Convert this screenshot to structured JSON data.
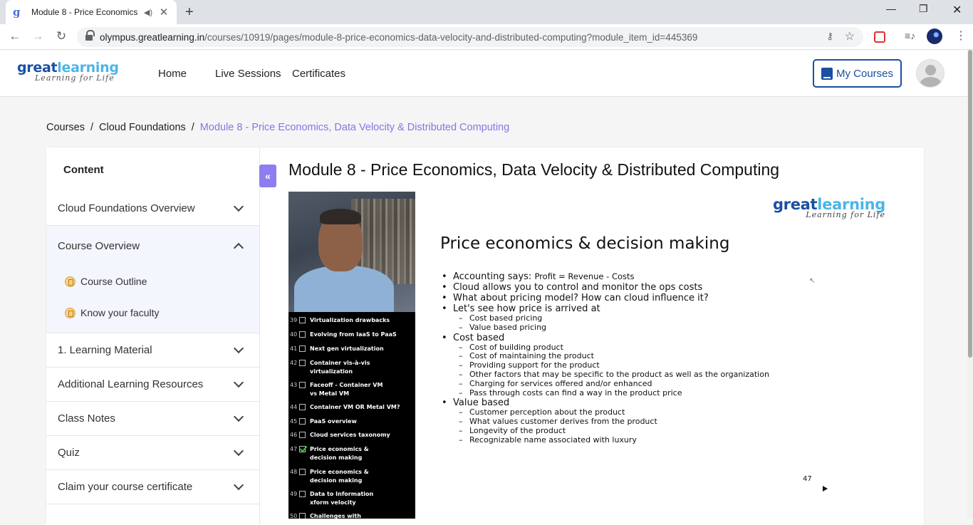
{
  "browser": {
    "tab_title": "Module 8 - Price Economics, Data Velocity & Distributed Computing",
    "url_host": "olympus.greatlearning.in",
    "url_path": "/courses/10919/pages/module-8-price-economics-data-velocity-and-distributed-computing?module_item_id=445369"
  },
  "header": {
    "logo_word_a": "great",
    "logo_word_b": "learning",
    "logo_tagline": "Learning for Life",
    "nav": [
      "Home",
      "Live Sessions",
      "Certificates"
    ],
    "my_courses": "My Courses"
  },
  "breadcrumb": {
    "items": [
      "Courses",
      "Cloud Foundations"
    ],
    "separator": "/",
    "current": "Module 8 - Price Economics, Data Velocity & Distributed Computing"
  },
  "sidebar": {
    "heading": "Content",
    "sections": [
      {
        "label": "Cloud Foundations Overview"
      },
      {
        "label": "Course Overview",
        "open": true,
        "items": [
          "Course Outline",
          "Know your faculty"
        ]
      },
      {
        "label": "1. Learning Material"
      },
      {
        "label": "Additional Learning Resources"
      },
      {
        "label": "Class Notes"
      },
      {
        "label": "Quiz"
      },
      {
        "label": "Claim your course certificate"
      }
    ],
    "collapse_glyph": "«"
  },
  "module": {
    "title": "Module 8 - Price Economics, Data Velocity & Distributed Computing"
  },
  "video": {
    "toc": [
      {
        "num": "39",
        "lines": [
          "Virtualization drawbacks"
        ],
        "checked": false
      },
      {
        "num": "40",
        "lines": [
          "Evolving from IaaS to PaaS"
        ],
        "checked": false
      },
      {
        "num": "41",
        "lines": [
          "Next gen virtualization"
        ],
        "checked": false
      },
      {
        "num": "42",
        "lines": [
          "Container vis-à-vis",
          "virtualization"
        ],
        "checked": false
      },
      {
        "num": "43",
        "lines": [
          "Faceoff - Container VM",
          "vs Metal VM"
        ],
        "checked": false
      },
      {
        "num": "44",
        "lines": [
          "Container VM OR Metal VM?"
        ],
        "checked": false
      },
      {
        "num": "45",
        "lines": [
          "PaaS overview"
        ],
        "checked": false
      },
      {
        "num": "46",
        "lines": [
          "Cloud services taxonomy"
        ],
        "checked": false
      },
      {
        "num": "47",
        "lines": [
          "Price economics &",
          "decision making"
        ],
        "checked": true
      },
      {
        "num": "48",
        "lines": [
          "Price economics &",
          "decision making"
        ],
        "checked": false
      },
      {
        "num": "49",
        "lines": [
          "Data to Information",
          "xform velocity"
        ],
        "checked": false
      },
      {
        "num": "50",
        "lines": [
          "Challenges with"
        ],
        "checked": false
      }
    ],
    "slide": {
      "logo_word_a": "great",
      "logo_word_b": "learning",
      "logo_tagline": "Learning for Life",
      "heading": "Price economics & decision making",
      "accounting_prefix": "Accounting says: ",
      "accounting_formula": "Profit = Revenue - Costs",
      "bullets_top": [
        "Cloud allows you to control and monitor the ops costs",
        "What about pricing model? How can cloud influence it?",
        "Let's see how price is arrived at"
      ],
      "pricing_subs": [
        "Cost based pricing",
        "Value based pricing"
      ],
      "cost_based": "Cost based",
      "cost_subs": [
        "Cost of building product",
        "Cost of maintaining the product",
        "Providing support for the product",
        "Other factors that may be specific to the product as well as the organization",
        "Charging for services offered and/or enhanced",
        "Pass through costs can find a way in the product price"
      ],
      "value_based": "Value based",
      "value_subs": [
        "Customer perception about the product",
        "What values customer derives from the product",
        "Longevity of the product",
        "Recognizable name associated with luxury"
      ],
      "page_number": "47"
    }
  }
}
